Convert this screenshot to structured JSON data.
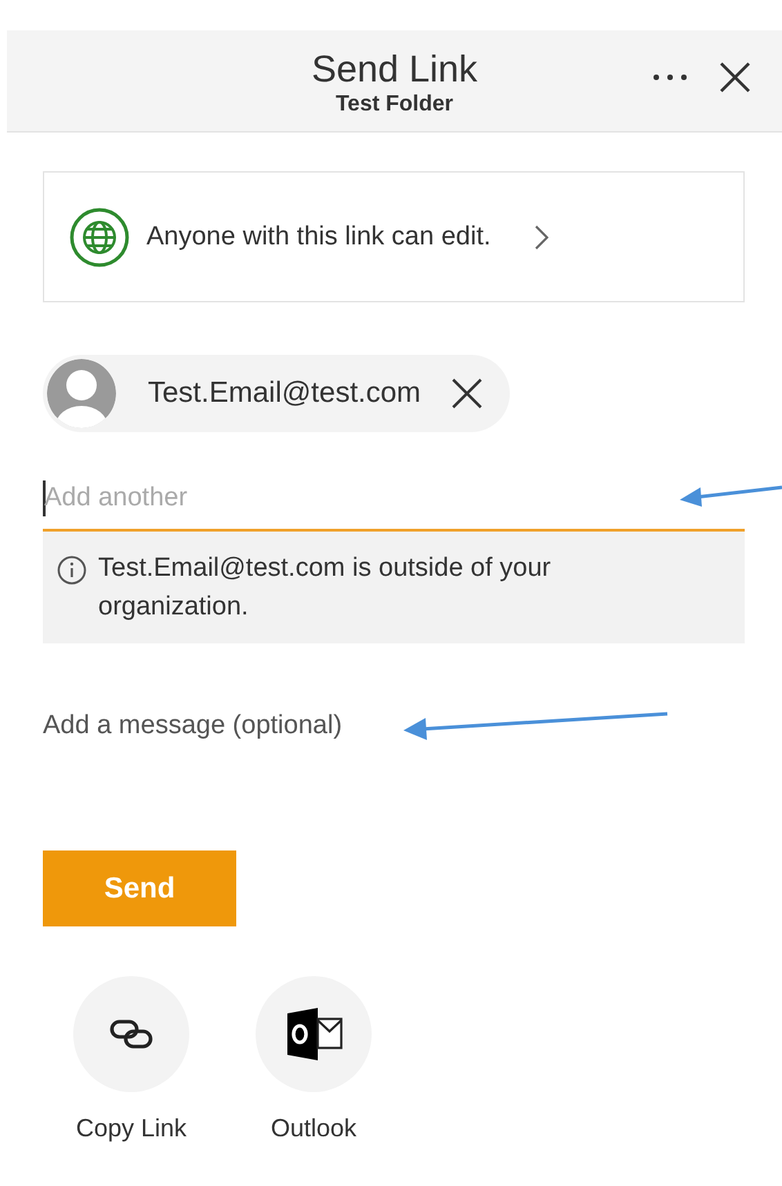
{
  "header": {
    "title": "Send Link",
    "subtitle": "Test Folder"
  },
  "permission": {
    "text": "Anyone with this link can edit."
  },
  "recipients": [
    {
      "email": "Test.Email@test.com"
    }
  ],
  "recipient_field": {
    "placeholder": "Add another",
    "focused": true
  },
  "notice": {
    "text": "Test.Email@test.com is outside of your organization."
  },
  "message": {
    "placeholder": "Add a message (optional)"
  },
  "send_button": "Send",
  "share_options": [
    {
      "kind": "copy-link",
      "label": "Copy Link"
    },
    {
      "kind": "outlook",
      "label": "Outlook"
    }
  ]
}
